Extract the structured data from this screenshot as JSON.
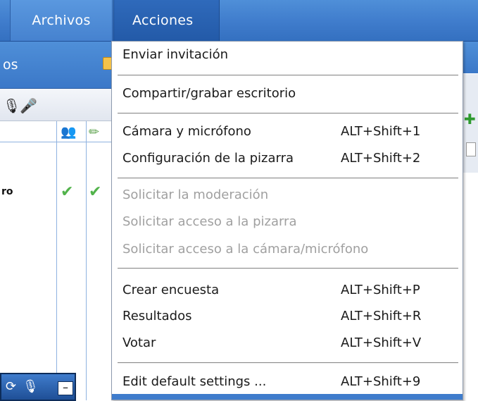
{
  "menubar": {
    "tabs": [
      {
        "label": "Archivos"
      },
      {
        "label": "Acciones"
      }
    ]
  },
  "left_panel": {
    "title": "os",
    "row_name": "ro",
    "icons": [
      "mic-icon",
      "microphone-icon",
      "users-icon",
      "pencil-icon",
      "check-icon",
      "refresh-icon",
      "minimize-icon"
    ]
  },
  "right_panel": {
    "icons": [
      "plus-icon"
    ]
  },
  "dropdown": {
    "items": [
      {
        "label": "Enviar invitación",
        "shortcut": ""
      },
      {
        "label": "Compartir/grabar escritorio",
        "shortcut": ""
      },
      {
        "label": "Cámara y micrófono",
        "shortcut": "ALT+Shift+1"
      },
      {
        "label": "Configuración de la pizarra",
        "shortcut": "ALT+Shift+2"
      },
      {
        "label": "Solicitar la moderación",
        "shortcut": ""
      },
      {
        "label": "Solicitar acceso a la pizarra",
        "shortcut": ""
      },
      {
        "label": "Solicitar acceso a la cámara/micrófono",
        "shortcut": ""
      },
      {
        "label": "Crear encuesta",
        "shortcut": "ALT+Shift+P"
      },
      {
        "label": "Resultados",
        "shortcut": "ALT+Shift+R"
      },
      {
        "label": "Votar",
        "shortcut": "ALT+Shift+V"
      },
      {
        "label": "Edit default settings ...",
        "shortcut": "ALT+Shift+9"
      }
    ]
  },
  "colors": {
    "menubar_blue": "#3f7ccc",
    "active_tab": "#235aa8",
    "disabled_text": "#a0a0a0",
    "check_green": "#52b34b"
  }
}
